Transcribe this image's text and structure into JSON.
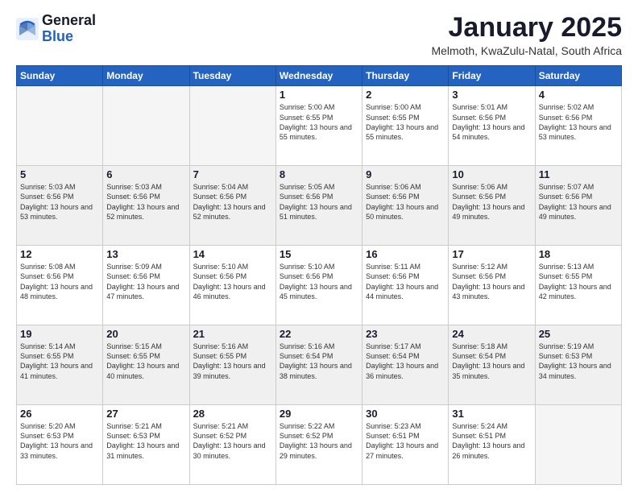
{
  "header": {
    "logo_line1": "General",
    "logo_line2": "Blue",
    "month": "January 2025",
    "location": "Melmoth, KwaZulu-Natal, South Africa"
  },
  "weekdays": [
    "Sunday",
    "Monday",
    "Tuesday",
    "Wednesday",
    "Thursday",
    "Friday",
    "Saturday"
  ],
  "weeks": [
    {
      "shaded": false,
      "days": [
        {
          "num": "",
          "text": ""
        },
        {
          "num": "",
          "text": ""
        },
        {
          "num": "",
          "text": ""
        },
        {
          "num": "1",
          "text": "Sunrise: 5:00 AM\nSunset: 6:55 PM\nDaylight: 13 hours\nand 55 minutes."
        },
        {
          "num": "2",
          "text": "Sunrise: 5:00 AM\nSunset: 6:55 PM\nDaylight: 13 hours\nand 55 minutes."
        },
        {
          "num": "3",
          "text": "Sunrise: 5:01 AM\nSunset: 6:56 PM\nDaylight: 13 hours\nand 54 minutes."
        },
        {
          "num": "4",
          "text": "Sunrise: 5:02 AM\nSunset: 6:56 PM\nDaylight: 13 hours\nand 53 minutes."
        }
      ]
    },
    {
      "shaded": true,
      "days": [
        {
          "num": "5",
          "text": "Sunrise: 5:03 AM\nSunset: 6:56 PM\nDaylight: 13 hours\nand 53 minutes."
        },
        {
          "num": "6",
          "text": "Sunrise: 5:03 AM\nSunset: 6:56 PM\nDaylight: 13 hours\nand 52 minutes."
        },
        {
          "num": "7",
          "text": "Sunrise: 5:04 AM\nSunset: 6:56 PM\nDaylight: 13 hours\nand 52 minutes."
        },
        {
          "num": "8",
          "text": "Sunrise: 5:05 AM\nSunset: 6:56 PM\nDaylight: 13 hours\nand 51 minutes."
        },
        {
          "num": "9",
          "text": "Sunrise: 5:06 AM\nSunset: 6:56 PM\nDaylight: 13 hours\nand 50 minutes."
        },
        {
          "num": "10",
          "text": "Sunrise: 5:06 AM\nSunset: 6:56 PM\nDaylight: 13 hours\nand 49 minutes."
        },
        {
          "num": "11",
          "text": "Sunrise: 5:07 AM\nSunset: 6:56 PM\nDaylight: 13 hours\nand 49 minutes."
        }
      ]
    },
    {
      "shaded": false,
      "days": [
        {
          "num": "12",
          "text": "Sunrise: 5:08 AM\nSunset: 6:56 PM\nDaylight: 13 hours\nand 48 minutes."
        },
        {
          "num": "13",
          "text": "Sunrise: 5:09 AM\nSunset: 6:56 PM\nDaylight: 13 hours\nand 47 minutes."
        },
        {
          "num": "14",
          "text": "Sunrise: 5:10 AM\nSunset: 6:56 PM\nDaylight: 13 hours\nand 46 minutes."
        },
        {
          "num": "15",
          "text": "Sunrise: 5:10 AM\nSunset: 6:56 PM\nDaylight: 13 hours\nand 45 minutes."
        },
        {
          "num": "16",
          "text": "Sunrise: 5:11 AM\nSunset: 6:56 PM\nDaylight: 13 hours\nand 44 minutes."
        },
        {
          "num": "17",
          "text": "Sunrise: 5:12 AM\nSunset: 6:56 PM\nDaylight: 13 hours\nand 43 minutes."
        },
        {
          "num": "18",
          "text": "Sunrise: 5:13 AM\nSunset: 6:55 PM\nDaylight: 13 hours\nand 42 minutes."
        }
      ]
    },
    {
      "shaded": true,
      "days": [
        {
          "num": "19",
          "text": "Sunrise: 5:14 AM\nSunset: 6:55 PM\nDaylight: 13 hours\nand 41 minutes."
        },
        {
          "num": "20",
          "text": "Sunrise: 5:15 AM\nSunset: 6:55 PM\nDaylight: 13 hours\nand 40 minutes."
        },
        {
          "num": "21",
          "text": "Sunrise: 5:16 AM\nSunset: 6:55 PM\nDaylight: 13 hours\nand 39 minutes."
        },
        {
          "num": "22",
          "text": "Sunrise: 5:16 AM\nSunset: 6:54 PM\nDaylight: 13 hours\nand 38 minutes."
        },
        {
          "num": "23",
          "text": "Sunrise: 5:17 AM\nSunset: 6:54 PM\nDaylight: 13 hours\nand 36 minutes."
        },
        {
          "num": "24",
          "text": "Sunrise: 5:18 AM\nSunset: 6:54 PM\nDaylight: 13 hours\nand 35 minutes."
        },
        {
          "num": "25",
          "text": "Sunrise: 5:19 AM\nSunset: 6:53 PM\nDaylight: 13 hours\nand 34 minutes."
        }
      ]
    },
    {
      "shaded": false,
      "days": [
        {
          "num": "26",
          "text": "Sunrise: 5:20 AM\nSunset: 6:53 PM\nDaylight: 13 hours\nand 33 minutes."
        },
        {
          "num": "27",
          "text": "Sunrise: 5:21 AM\nSunset: 6:53 PM\nDaylight: 13 hours\nand 31 minutes."
        },
        {
          "num": "28",
          "text": "Sunrise: 5:21 AM\nSunset: 6:52 PM\nDaylight: 13 hours\nand 30 minutes."
        },
        {
          "num": "29",
          "text": "Sunrise: 5:22 AM\nSunset: 6:52 PM\nDaylight: 13 hours\nand 29 minutes."
        },
        {
          "num": "30",
          "text": "Sunrise: 5:23 AM\nSunset: 6:51 PM\nDaylight: 13 hours\nand 27 minutes."
        },
        {
          "num": "31",
          "text": "Sunrise: 5:24 AM\nSunset: 6:51 PM\nDaylight: 13 hours\nand 26 minutes."
        },
        {
          "num": "",
          "text": ""
        }
      ]
    }
  ]
}
